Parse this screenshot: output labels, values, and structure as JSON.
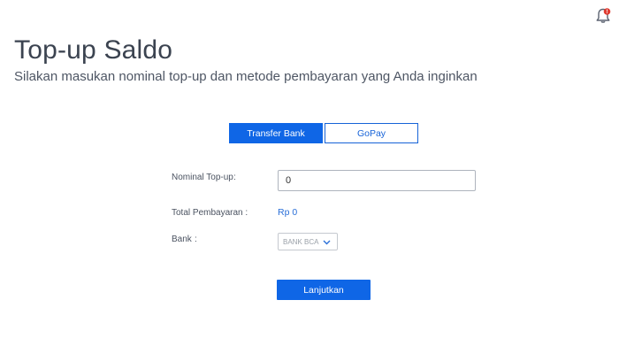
{
  "header": {
    "notification_icon": "bell-icon",
    "notification_badge": "!"
  },
  "page": {
    "title": "Top-up Saldo",
    "subtitle": "Silakan masukan nominal top-up dan metode pembayaran yang Anda inginkan"
  },
  "tabs": [
    {
      "label": "Transfer Bank",
      "active": true
    },
    {
      "label": "GoPay",
      "active": false
    }
  ],
  "form": {
    "nominal_label": "Nominal Top-up",
    "nominal_separator": ":",
    "nominal_value": "0",
    "total_label": "Total Pembayaran :",
    "total_value": "Rp 0",
    "bank_label": "Bank",
    "bank_separator": ":",
    "bank_selected": "BANK BCA",
    "submit_label": "Lanjutkan"
  },
  "colors": {
    "accent": "#0f66e6",
    "badge": "#e03c31",
    "link": "#2a6fd8"
  }
}
